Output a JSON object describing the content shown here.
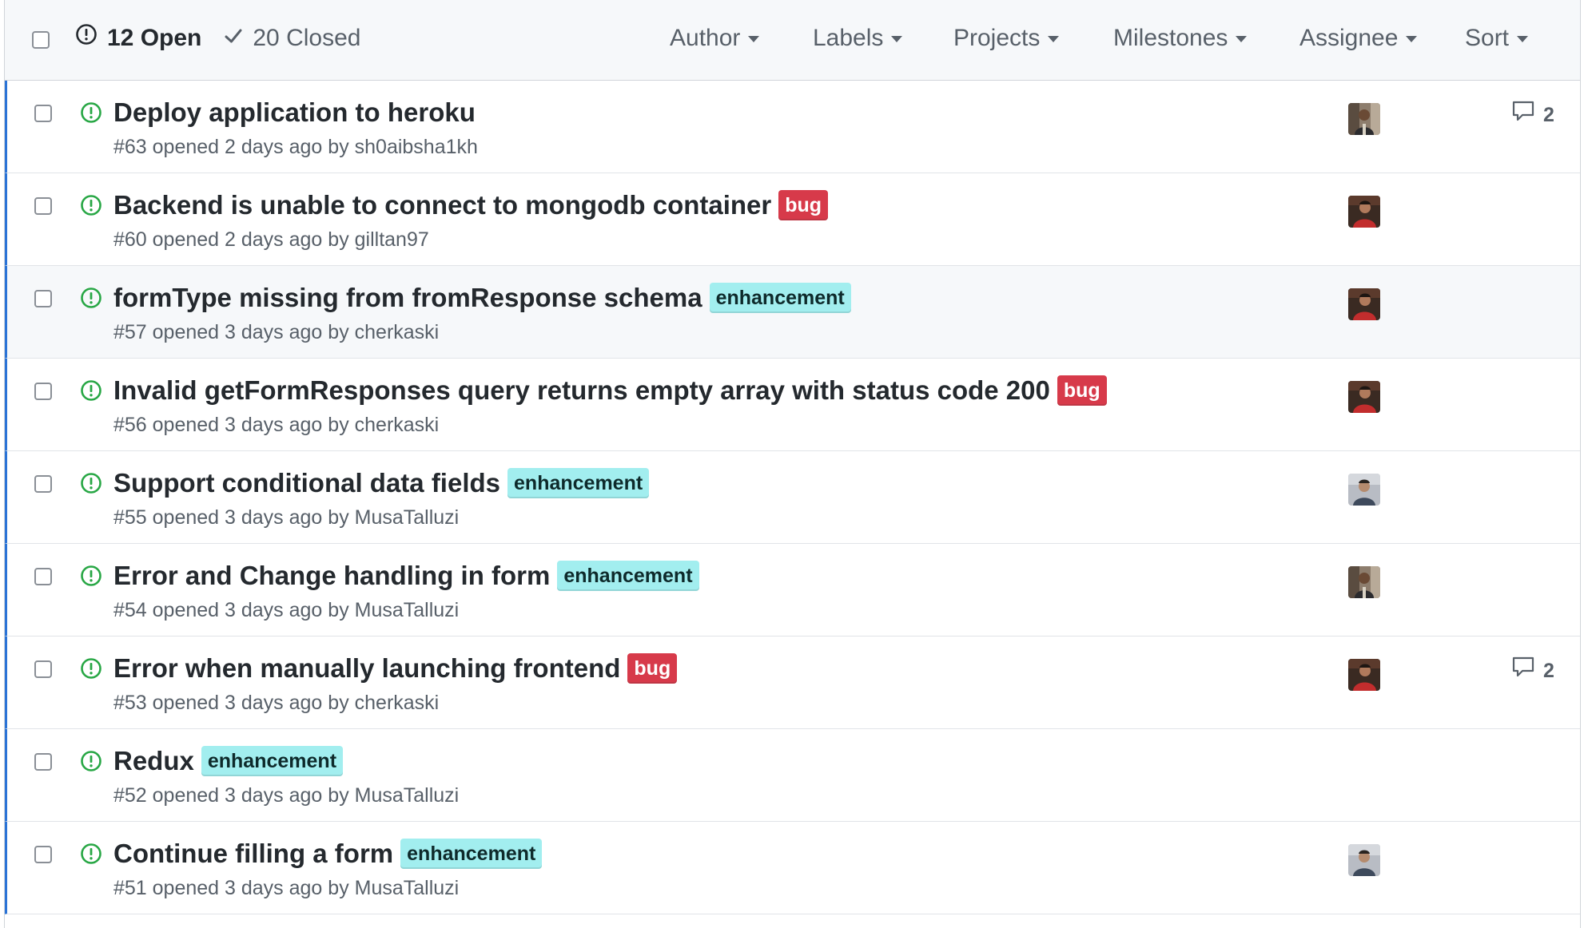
{
  "header": {
    "open_count": "12 Open",
    "closed_count": "20 Closed",
    "filters": [
      {
        "label": "Author"
      },
      {
        "label": "Labels"
      },
      {
        "label": "Projects"
      },
      {
        "label": "Milestones"
      },
      {
        "label": "Assignee"
      },
      {
        "label": "Sort"
      }
    ]
  },
  "colors": {
    "accent_border": "#2a73d6",
    "open_icon": "#28a745",
    "bug_bg": "#d73a4a",
    "bug_fg": "#ffffff",
    "enhancement_bg": "#a2eeef",
    "enhancement_fg": "#0e2a2b"
  },
  "issues": [
    {
      "title": "Deploy application to heroku",
      "label": "",
      "label_type": "",
      "meta": "#63 opened 2 days ago by sh0aibsha1kh",
      "avatar": "avatar-a",
      "comments": "2"
    },
    {
      "title": "Backend is unable to connect to mongodb container",
      "label": "bug",
      "label_type": "bug",
      "meta": "#60 opened 2 days ago by gilltan97",
      "avatar": "avatar-b",
      "comments": ""
    },
    {
      "title": "formType missing from fromResponse schema",
      "label": "enhancement",
      "label_type": "enhancement",
      "meta": "#57 opened 3 days ago by cherkaski",
      "avatar": "avatar-b",
      "comments": ""
    },
    {
      "title": "Invalid getFormResponses query returns empty array with status code 200",
      "label": "bug",
      "label_type": "bug",
      "meta": "#56 opened 3 days ago by cherkaski",
      "avatar": "avatar-b",
      "comments": ""
    },
    {
      "title": "Support conditional data fields",
      "label": "enhancement",
      "label_type": "enhancement",
      "meta": "#55 opened 3 days ago by MusaTalluzi",
      "avatar": "avatar-c",
      "comments": ""
    },
    {
      "title": "Error and Change handling in form",
      "label": "enhancement",
      "label_type": "enhancement",
      "meta": "#54 opened 3 days ago by MusaTalluzi",
      "avatar": "avatar-a",
      "comments": ""
    },
    {
      "title": "Error when manually launching frontend",
      "label": "bug",
      "label_type": "bug",
      "meta": "#53 opened 3 days ago by cherkaski",
      "avatar": "avatar-b",
      "comments": "2"
    },
    {
      "title": "Redux",
      "label": "enhancement",
      "label_type": "enhancement",
      "meta": "#52 opened 3 days ago by MusaTalluzi",
      "avatar": "",
      "comments": ""
    },
    {
      "title": "Continue filling a form",
      "label": "enhancement",
      "label_type": "enhancement",
      "meta": "#51 opened 3 days ago by MusaTalluzi",
      "avatar": "avatar-c",
      "comments": ""
    }
  ]
}
